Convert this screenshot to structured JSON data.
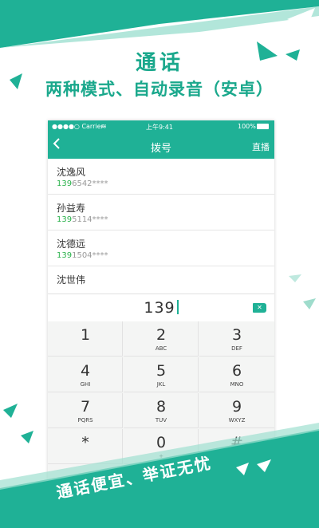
{
  "promo": {
    "title": "通话",
    "subtitle": "两种模式、自动录音（安卓）",
    "slogan": "通话便宜、举证无忧"
  },
  "status_bar": {
    "carrier": "●●●●○ Carrier",
    "time": "上午9:41",
    "battery": "100%"
  },
  "nav": {
    "back_icon": "chevron-left-icon",
    "title": "拨号",
    "action": "直播"
  },
  "contacts": [
    {
      "name": "沈逸风",
      "number_match": "139",
      "number_rest": "6542****"
    },
    {
      "name": "孙益寿",
      "number_match": "139",
      "number_rest": "5114****"
    },
    {
      "name": "沈德远",
      "number_match": "139",
      "number_rest": "1504****"
    },
    {
      "name": "沈世伟",
      "number_match": "",
      "number_rest": ""
    }
  ],
  "dial_input": {
    "value": "139",
    "delete_icon": "backspace-icon"
  },
  "keypad": [
    {
      "digit": "1",
      "letters": ""
    },
    {
      "digit": "2",
      "letters": "ABC"
    },
    {
      "digit": "3",
      "letters": "DEF"
    },
    {
      "digit": "4",
      "letters": "GHI"
    },
    {
      "digit": "5",
      "letters": "JKL"
    },
    {
      "digit": "6",
      "letters": "MNO"
    },
    {
      "digit": "7",
      "letters": "PQRS"
    },
    {
      "digit": "8",
      "letters": "TUV"
    },
    {
      "digit": "9",
      "letters": "WXYZ"
    },
    {
      "digit": "*",
      "letters": ""
    },
    {
      "digit": "0",
      "letters": "+"
    },
    {
      "digit": "#",
      "letters": ""
    }
  ],
  "colors": {
    "accent": "#1fb196",
    "headline": "#1aa88c",
    "match_highlight": "#2bb24c"
  }
}
